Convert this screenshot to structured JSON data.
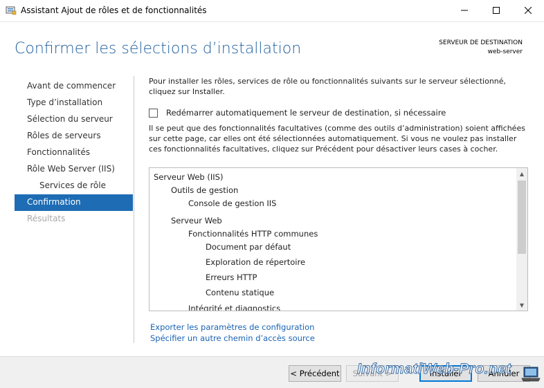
{
  "window": {
    "title": "Assistant Ajout de rôles et de fonctionnalités",
    "controls": {
      "minimize": "—",
      "maximize": "☐",
      "close": "✕"
    }
  },
  "header": {
    "page_title": "Confirmer les sélections d’installation",
    "destination_label": "SERVEUR DE DESTINATION",
    "destination_server": "web-server"
  },
  "nav": {
    "items": [
      {
        "label": "Avant de commencer",
        "state": "normal",
        "sub": false
      },
      {
        "label": "Type d’installation",
        "state": "normal",
        "sub": false
      },
      {
        "label": "Sélection du serveur",
        "state": "normal",
        "sub": false
      },
      {
        "label": "Rôles de serveurs",
        "state": "normal",
        "sub": false
      },
      {
        "label": "Fonctionnalités",
        "state": "normal",
        "sub": false
      },
      {
        "label": "Rôle Web Server (IIS)",
        "state": "normal",
        "sub": false
      },
      {
        "label": "Services de rôle",
        "state": "normal",
        "sub": true
      },
      {
        "label": "Confirmation",
        "state": "active",
        "sub": false
      },
      {
        "label": "Résultats",
        "state": "disabled",
        "sub": false
      }
    ]
  },
  "main": {
    "intro": "Pour installer les rôles, services de rôle ou fonctionnalités suivants sur le serveur sélectionné, cliquez sur Installer.",
    "restart_checkbox": {
      "label": "Redémarrer automatiquement le serveur de destination, si nécessaire",
      "checked": false
    },
    "optional_note": "Il se peut que des fonctionnalités facultatives (comme des outils d’administration) soient affichées sur cette page, car elles ont été sélectionnées automatiquement. Si vous ne voulez pas installer ces fonctionnalités facultatives, cliquez sur Précédent pour désactiver leurs cases à cocher.",
    "selection_tree": [
      {
        "label": "Serveur Web (IIS)",
        "level": 0
      },
      {
        "label": "Outils de gestion",
        "level": 1
      },
      {
        "label": "Console de gestion IIS",
        "level": 2
      },
      {
        "label": "Serveur Web",
        "level": 1
      },
      {
        "label": "Fonctionnalités HTTP communes",
        "level": 2
      },
      {
        "label": "Document par défaut",
        "level": 3
      },
      {
        "label": "Exploration de répertoire",
        "level": 3
      },
      {
        "label": "Erreurs HTTP",
        "level": 3
      },
      {
        "label": "Contenu statique",
        "level": 3
      },
      {
        "label": "Intégrité et diagnostics",
        "level": 2
      }
    ],
    "links": {
      "export": "Exporter les paramètres de configuration",
      "alt_source": "Spécifier un autre chemin d’accès source"
    }
  },
  "footer": {
    "prev": "< Précédent",
    "next": "Suivant >",
    "install": "Installer",
    "cancel": "Annuler"
  },
  "watermark": "InformatiWeb-Pro.net",
  "colors": {
    "title_blue": "#1e5f9e",
    "nav_active_bg": "#1e6cb4",
    "link_blue": "#1a63b5",
    "footer_bg": "#f0f0f0"
  }
}
